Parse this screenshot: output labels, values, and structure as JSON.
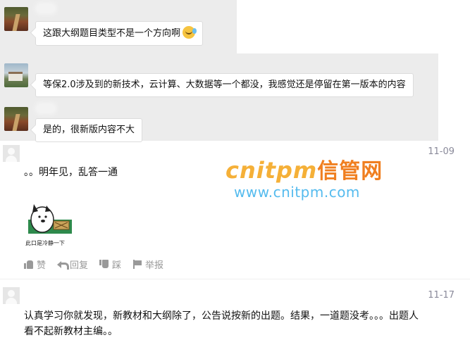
{
  "chat": {
    "messages": [
      {
        "avatar": "road-photo-avatar",
        "text": "这跟大纲题目类型不是一个方向啊",
        "emoji": "laughing-tears-emoji"
      },
      {
        "avatar": "house-photo-avatar",
        "text": "等保2.0涉及到的新技术，云计算、大数据等一个都没，我感觉还是停留在第一版本的内容"
      },
      {
        "avatar": "road-photo-avatar",
        "text": "是的，很新版内容不大"
      }
    ]
  },
  "comments": [
    {
      "date": "11-09",
      "text": "。。明年见，乱答一通",
      "sticker_caption": "此口是冷静一下",
      "actions": {
        "like": "赞",
        "reply": "回复",
        "dislike": "踩",
        "report": "举报"
      }
    },
    {
      "date": "11-17",
      "text_line1": "认真学习你就发现，新教材和大纲除了，公告说按新的出题。结果，一道题没考。。。出题人",
      "text_line2": "看不起新教材主编。。"
    }
  ],
  "watermark": {
    "brand": "cnitpm",
    "brand_cn": "信管网",
    "url": "www.cnitpm.com"
  },
  "colors": {
    "chat_bg": "#ececec",
    "date": "#8a8a9a",
    "watermark_orange": "#f5b038",
    "watermark_blue": "#55bbee"
  }
}
